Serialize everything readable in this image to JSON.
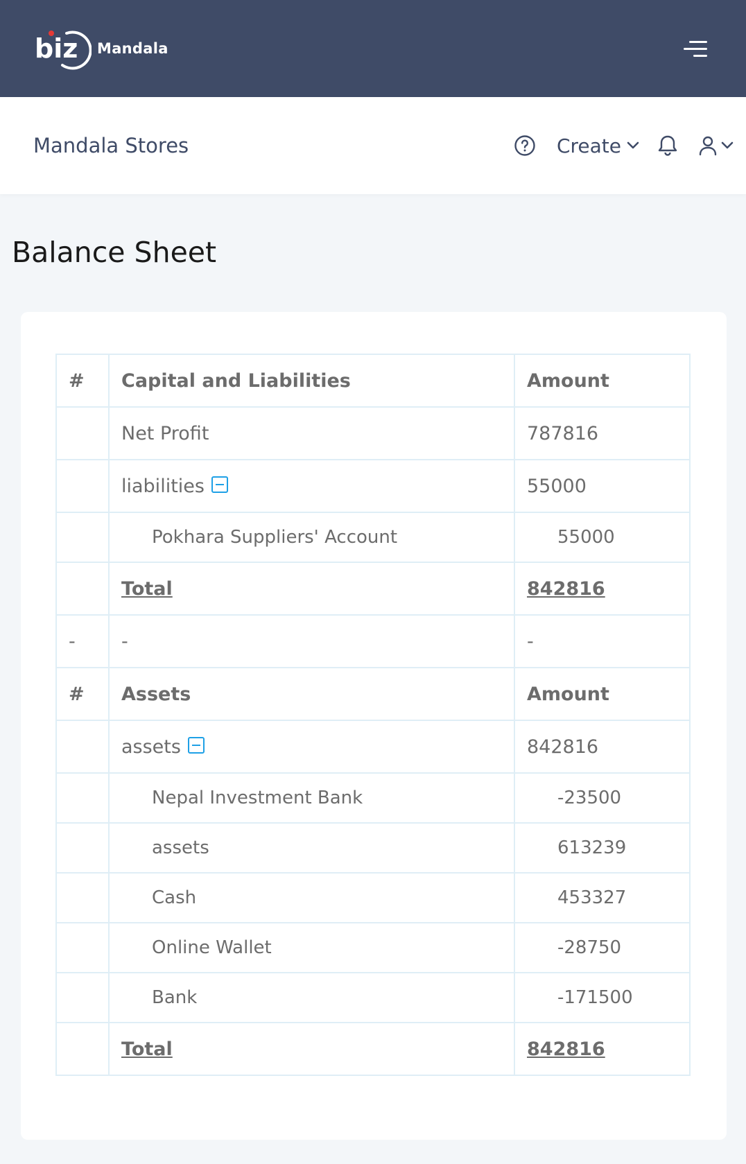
{
  "brand": {
    "logo_text": "biz",
    "name": "Mandala"
  },
  "subheader": {
    "store_name": "Mandala Stores",
    "create_label": "Create"
  },
  "page": {
    "title": "Balance Sheet"
  },
  "capital_section": {
    "header": {
      "num": "#",
      "label": "Capital and Liabilities",
      "amount": "Amount"
    },
    "rows": [
      {
        "label": "Net Profit",
        "amount": "787816"
      },
      {
        "label": "liabilities",
        "amount": "55000"
      }
    ],
    "sub_rows": [
      {
        "label": "Pokhara Suppliers' Account",
        "amount": "55000"
      }
    ],
    "total": {
      "label": "Total",
      "amount": "842816"
    }
  },
  "separator": {
    "num": "-",
    "label": "-",
    "amount": "-"
  },
  "assets_section": {
    "header": {
      "num": "#",
      "label": "Assets",
      "amount": "Amount"
    },
    "group": {
      "label": "assets",
      "amount": "842816"
    },
    "sub_rows": [
      {
        "label": "Nepal Investment Bank",
        "amount": "-23500"
      },
      {
        "label": "assets",
        "amount": "613239"
      },
      {
        "label": "Cash",
        "amount": "453327"
      },
      {
        "label": "Online Wallet",
        "amount": "-28750"
      },
      {
        "label": "Bank",
        "amount": "-171500"
      }
    ],
    "total": {
      "label": "Total",
      "amount": "842816"
    }
  },
  "colors": {
    "header_bg": "#3f4b67",
    "accent": "#1ea0e6",
    "logo_dot": "#e53935"
  },
  "icons": [
    "menu-icon",
    "help-icon",
    "chevron-down-icon",
    "bell-icon",
    "user-icon",
    "collapse-icon"
  ]
}
